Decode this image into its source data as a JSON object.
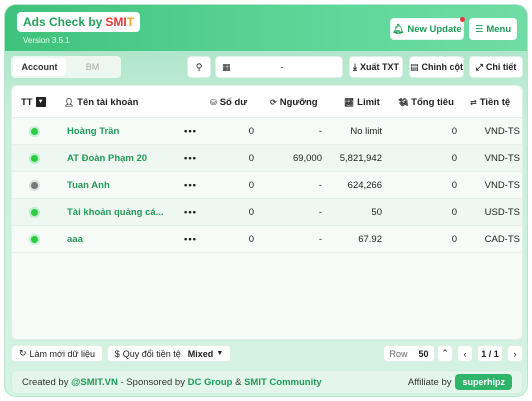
{
  "header": {
    "app_name": "Ads Check by",
    "brand": "SMI",
    "brand_suffix": "T",
    "version": "Version 3.5.1",
    "update_label": "New Update",
    "menu_label": "Menu"
  },
  "tabs": [
    {
      "label": "Account",
      "active": true
    },
    {
      "label": "BM",
      "active": false
    }
  ],
  "toolbar": {
    "date_value": "-",
    "export_label": "Xuất TXT",
    "columns_label": "Chỉnh cột",
    "details_label": "Chi tiết"
  },
  "table": {
    "headers": {
      "status": "TT",
      "name": "Tên tài khoản",
      "balance": "Số dư",
      "threshold": "Ngưỡng",
      "limit": "Limit",
      "spent": "Tổng tiêu",
      "currency": "Tiền tệ"
    },
    "rows": [
      {
        "name": "Hoàng Trần",
        "balance": "0",
        "threshold": "-",
        "limit": "No limit",
        "spent": "0",
        "currency": "VND-TS",
        "status_color": "#2ecc40"
      },
      {
        "name": "AT Đoàn Phạm 20",
        "balance": "0",
        "threshold": "69,000",
        "limit": "5,821,942",
        "spent": "0",
        "currency": "VND-TS",
        "status_color": "#2ecc40"
      },
      {
        "name": "Tuan Anh",
        "balance": "0",
        "threshold": "-",
        "limit": "624,266",
        "spent": "0",
        "currency": "VND-TS",
        "status_color": "#777777"
      },
      {
        "name": "Tài khoản quảng cá...",
        "balance": "0",
        "threshold": "-",
        "limit": "50",
        "spent": "0",
        "currency": "USD-TS",
        "status_color": "#2ecc40"
      },
      {
        "name": "aaa",
        "balance": "0",
        "threshold": "-",
        "limit": "67.92",
        "spent": "0",
        "currency": "CAD-TS",
        "status_color": "#2ecc40"
      }
    ]
  },
  "footer_controls": {
    "refresh_label": "Làm mới dữ liệu",
    "convert_label": "Quy đổi tiền tệ",
    "convert_value": "Mixed",
    "row_label": "Row",
    "row_value": "50",
    "page_label": "1 / 1"
  },
  "credits": {
    "created_by": "Created by",
    "smit_vn": "@SMIT.VN",
    "sponsored": "- Sponsored by",
    "dc_group": "DC Group",
    "amp": "&",
    "smit_community": "SMIT Community",
    "affiliate": "Affiliate by",
    "affiliate_name": "superhipz"
  },
  "colors": {
    "accent": "#2fb56a",
    "name_green": "#1f9b57",
    "inactive_dot": "#777777"
  }
}
